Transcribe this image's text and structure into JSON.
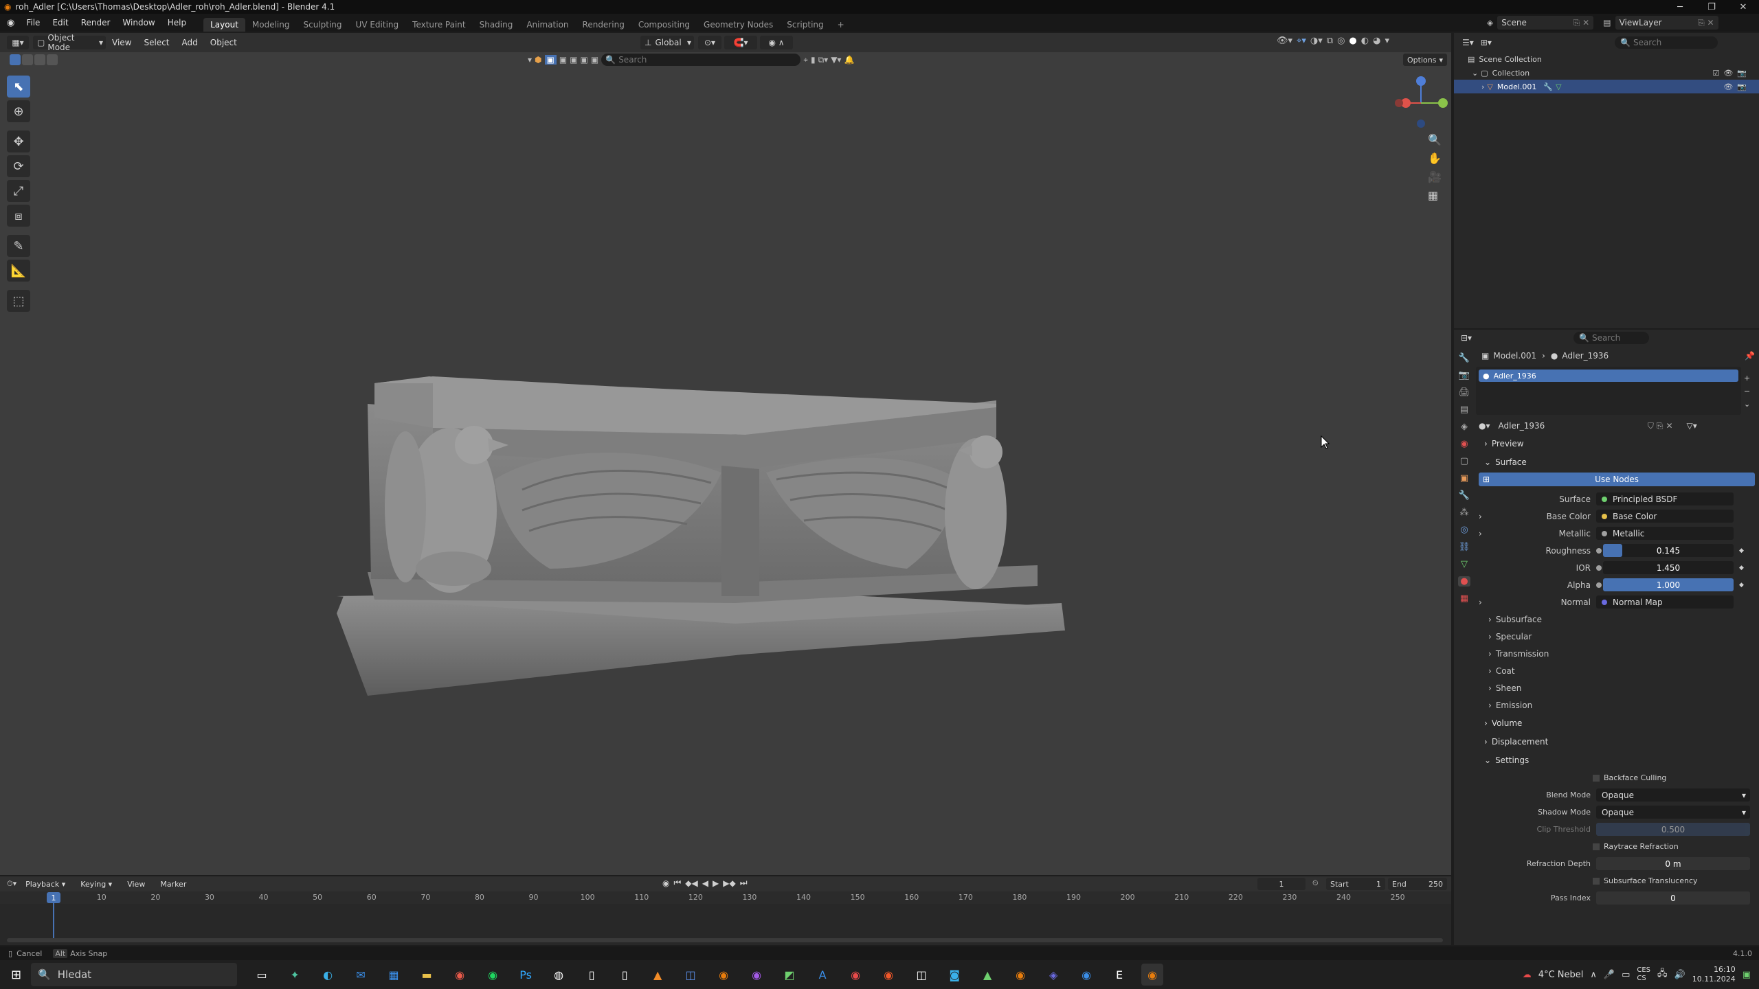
{
  "window": {
    "title": "roh_Adler [C:\\Users\\Thomas\\Desktop\\Adler_roh\\roh_Adler.blend] - Blender 4.1"
  },
  "menu": [
    "File",
    "Edit",
    "Render",
    "Window",
    "Help"
  ],
  "workspaces": [
    "Layout",
    "Modeling",
    "Sculpting",
    "UV Editing",
    "Texture Paint",
    "Shading",
    "Animation",
    "Rendering",
    "Compositing",
    "Geometry Nodes",
    "Scripting"
  ],
  "active_workspace": "Layout",
  "scene": {
    "scene_name": "Scene",
    "view_layer": "ViewLayer",
    "search_placeholder": "Search"
  },
  "viewport_header": {
    "mode": "Object Mode",
    "menus": [
      "View",
      "Select",
      "Add",
      "Object"
    ],
    "orientation": "Global",
    "options": "Options",
    "search_placeholder": "Search"
  },
  "outliner": {
    "search_placeholder": "Search",
    "scene_collection": "Scene Collection",
    "collection": "Collection",
    "object": "Model.001"
  },
  "properties": {
    "search_placeholder": "Search",
    "breadcrumb_object": "Model.001",
    "breadcrumb_material": "Adler_1936",
    "slot_name": "Adler_1936",
    "material_name": "Adler_1936",
    "panels": {
      "preview": "Preview",
      "surface": "Surface",
      "volume": "Volume",
      "displacement": "Displacement",
      "settings": "Settings"
    },
    "use_nodes": "Use Nodes",
    "surface": {
      "surface_label": "Surface",
      "surface_value": "Principled BSDF",
      "base_color_label": "Base Color",
      "base_color_value": "Base Color",
      "metallic_label": "Metallic",
      "metallic_value": "Metallic",
      "roughness_label": "Roughness",
      "roughness_value": "0.145",
      "ior_label": "IOR",
      "ior_value": "1.450",
      "alpha_label": "Alpha",
      "alpha_value": "1.000",
      "normal_label": "Normal",
      "normal_value": "Normal Map"
    },
    "surface_fill": {
      "roughness": 0.145,
      "alpha": 1.0
    },
    "subpanels": [
      "Subsurface",
      "Specular",
      "Transmission",
      "Coat",
      "Sheen",
      "Emission"
    ],
    "settings": {
      "backface_culling": "Backface Culling",
      "blend_mode_label": "Blend Mode",
      "blend_mode_value": "Opaque",
      "shadow_mode_label": "Shadow Mode",
      "shadow_mode_value": "Opaque",
      "clip_threshold_label": "Clip Threshold",
      "clip_threshold_value": "0.500",
      "raytrace_refraction": "Raytrace Refraction",
      "refraction_depth_label": "Refraction Depth",
      "refraction_depth_value": "0 m",
      "subsurface_translucency": "Subsurface Translucency",
      "pass_index_label": "Pass Index",
      "pass_index_value": "0"
    }
  },
  "timeline": {
    "menus": [
      "Playback",
      "Keying",
      "View",
      "Marker"
    ],
    "current_frame": "1",
    "start_label": "Start",
    "start_value": "1",
    "end_label": "End",
    "end_value": "250",
    "ruler_ticks": [
      "10",
      "20",
      "30",
      "40",
      "50",
      "60",
      "70",
      "80",
      "90",
      "100",
      "110",
      "120",
      "130",
      "140",
      "150",
      "160",
      "170",
      "180",
      "190",
      "200",
      "210",
      "220",
      "230",
      "240",
      "250"
    ]
  },
  "statusbar": {
    "cancel": "Cancel",
    "alt_key": "Alt",
    "axis_snap": "Axis Snap",
    "version": "4.1.0"
  },
  "taskbar": {
    "search_placeholder": "Hledat",
    "weather": "4°C  Nebel",
    "lang": "CES",
    "lang2": "CS",
    "time": "16:10",
    "date": "10.11.2024"
  }
}
